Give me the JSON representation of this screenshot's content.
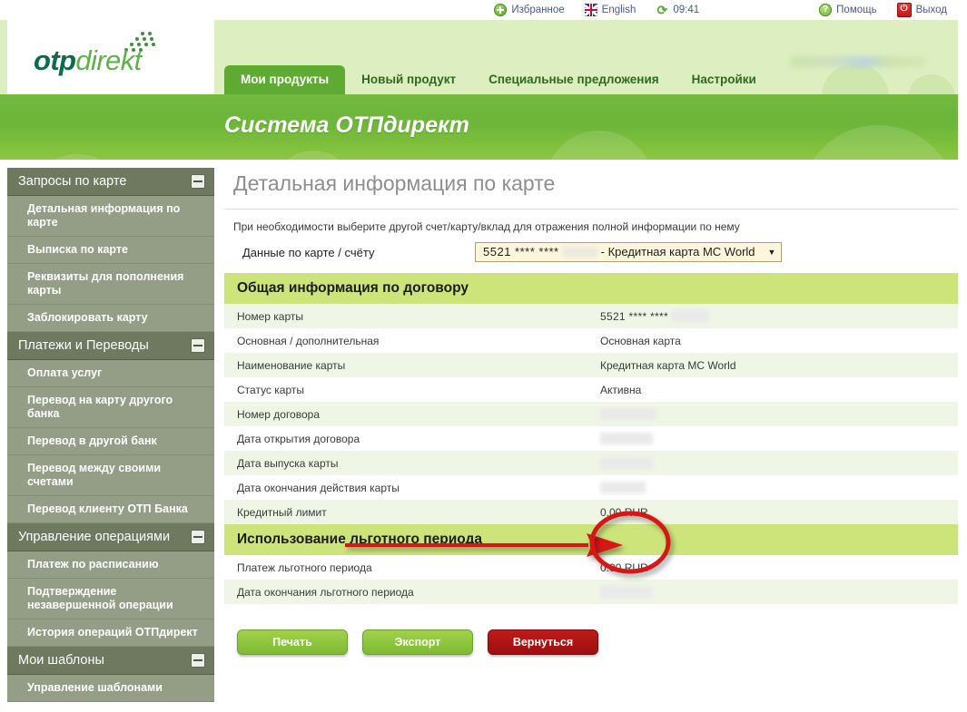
{
  "topbar": {
    "favorites": "Избранное",
    "language": "English",
    "time": "09:41",
    "help": "Помощь",
    "exit": "Выход"
  },
  "logo": {
    "part1": "otp",
    "part2": "direkt"
  },
  "tabs": [
    {
      "label": "Мои продукты",
      "active": true
    },
    {
      "label": "Новый продукт",
      "active": false
    },
    {
      "label": "Специальные предложения",
      "active": false
    },
    {
      "label": "Настройки",
      "active": false
    }
  ],
  "banner": {
    "title": "Система ОТПдирект"
  },
  "sidebar": {
    "groups": [
      {
        "title": "Запросы по карте",
        "items": [
          "Детальная информация по карте",
          "Выписка по карте",
          "Реквизиты для пополнения карты",
          "Заблокировать карту"
        ]
      },
      {
        "title": "Платежи и Переводы",
        "items": [
          "Оплата услуг",
          "Перевод на карту другого банка",
          "Перевод в другой банк",
          "Перевод между своими счетами",
          "Перевод клиенту ОТП Банка"
        ]
      },
      {
        "title": "Управление операциями",
        "items": [
          "Платеж по расписанию",
          "Подтверждение незавершенной операции",
          "История операций ОТПдирект"
        ]
      },
      {
        "title": "Мои шаблоны",
        "items": [
          "Управление шаблонами"
        ]
      }
    ]
  },
  "main": {
    "page_title": "Детальная информация по карте",
    "hint": "При необходимости выберите другой счет/карту/вклад для отражения полной информации по нему",
    "select_label": "Данные по карте / счёту",
    "select_value_prefix": "5521 **** ****",
    "select_value_suffix": "- Кредитная карта MC World",
    "select_caret": "▼",
    "sections": [
      {
        "title": "Общая информация по договору",
        "rows": [
          {
            "key": "Номер карты",
            "value": "5521 **** ****",
            "redacted": true,
            "redact_width": 42
          },
          {
            "key": "Основная / дополнительная",
            "value": "Основная карта",
            "redacted": false
          },
          {
            "key": "Наименование карты",
            "value": "Кредитная карта MC World",
            "redacted": false
          },
          {
            "key": "Статус карты",
            "value": "Активна",
            "redacted": false
          },
          {
            "key": "Номер договора",
            "value": "",
            "redacted": true,
            "redact_width": 62
          },
          {
            "key": "Дата открытия договора",
            "value": "",
            "redacted": true,
            "redact_width": 58
          },
          {
            "key": "Дата выпуска карты",
            "value": "",
            "redacted": true,
            "redact_width": 58
          },
          {
            "key": "Дата окончания действия карты",
            "value": "",
            "redacted": true,
            "redact_width": 50
          },
          {
            "key": "Кредитный лимит",
            "value": "0.00 RUR",
            "redacted": false
          }
        ]
      },
      {
        "title": "Использование льготного периода",
        "rows": [
          {
            "key": "Платеж льготного периода",
            "value": "0.00 RUR",
            "redacted": false
          },
          {
            "key": "Дата окончания льготного периода",
            "value": "",
            "redacted": true,
            "redact_width": 58
          }
        ]
      }
    ],
    "buttons": [
      {
        "label": "Печать",
        "style": "green"
      },
      {
        "label": "Экспорт",
        "style": "green"
      },
      {
        "label": "Вернуться",
        "style": "red"
      }
    ]
  },
  "annotation": {
    "color": "#d81313",
    "target_text": "0.00 RUR",
    "description": "Красная стрелка и овал указывают на значение кредитного лимита"
  },
  "colors": {
    "header_band": "#ddeec0",
    "banner_green": "#6cb63a",
    "tab_active": "#5faa33",
    "section_header": "#cde47a",
    "sidebar_group": "#6e795f",
    "sidebar_item": "#949d86",
    "row_alt": "#f0f6e6",
    "annotation_red": "#d81313"
  }
}
